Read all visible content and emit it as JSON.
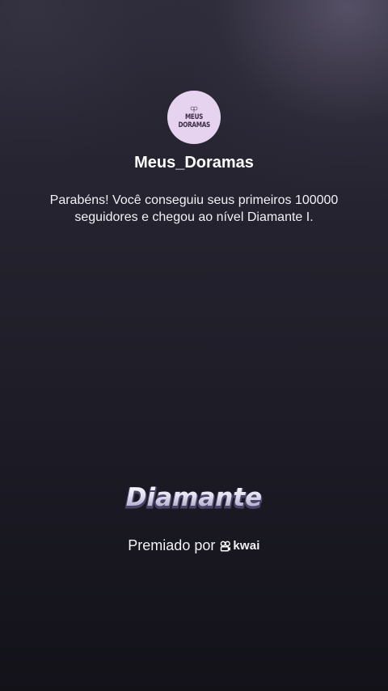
{
  "profile": {
    "avatar_text_line1": "MEUS",
    "avatar_text_line2": "DORAMAS",
    "name": "Meus_Doramas"
  },
  "message": "Parabéns! Você conseguiu seus primeiros 100000 seguidores e chegou ao nível Diamante I.",
  "badge": {
    "title": "Diamante"
  },
  "footer": {
    "awarded_by_label": "Premiado por",
    "brand": "kwai"
  },
  "colors": {
    "avatar_bg": "#e6d3ef",
    "text": "#ffffff",
    "badge_gradient_top": "#ffffff",
    "badge_gradient_bottom": "#9c95b8"
  },
  "icons": {
    "avatar_deco": "clover-icon",
    "brand": "kwai-logo-icon"
  }
}
